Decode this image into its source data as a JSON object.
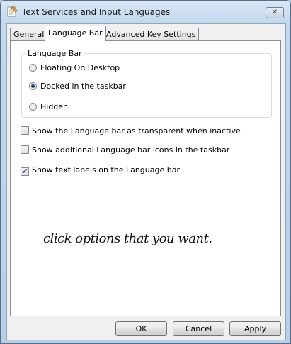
{
  "window": {
    "title": "Text Services and Input Languages",
    "close_icon_glyph": "✕"
  },
  "tabs": [
    {
      "label": "General",
      "active": false
    },
    {
      "label": "Language Bar",
      "active": true
    },
    {
      "label": "Advanced Key Settings",
      "active": false
    }
  ],
  "language_bar_group": {
    "legend": "Language Bar",
    "options": [
      {
        "label": "Floating On Desktop",
        "checked": false
      },
      {
        "label": "Docked in the taskbar",
        "checked": true
      },
      {
        "label": "Hidden",
        "checked": false
      }
    ]
  },
  "checkboxes": [
    {
      "label": "Show the Language bar as transparent when inactive",
      "checked": false
    },
    {
      "label": "Show additional Language bar icons in the taskbar",
      "checked": false
    },
    {
      "label": "Show text labels on the Language bar",
      "checked": true
    }
  ],
  "annotation": "click options that you want.",
  "buttons": {
    "ok": "OK",
    "cancel": "Cancel",
    "apply": "Apply"
  },
  "check_glyph": "✔"
}
